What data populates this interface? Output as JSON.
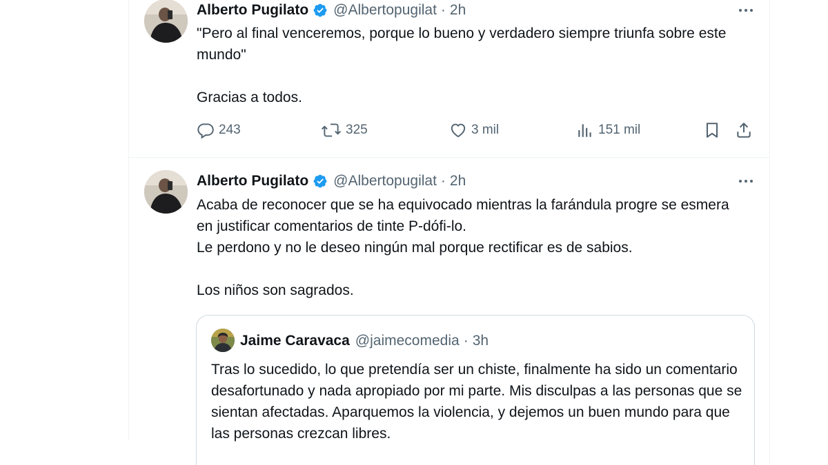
{
  "tweets": [
    {
      "author_name": "Alberto Pugilato",
      "handle": "@Albertopugilat",
      "separator": "·",
      "time": "2h",
      "paragraphs": [
        "\"Pero al final venceremos, porque lo bueno y verdadero siempre triunfa sobre este mundo\"",
        "Gracias a todos."
      ],
      "replies": "243",
      "retweets": "325",
      "likes": "3 mil",
      "views": "151 mil"
    },
    {
      "author_name": "Alberto Pugilato",
      "handle": "@Albertopugilat",
      "separator": "·",
      "time": "2h",
      "lines": [
        "Acaba de reconocer que se ha equivocado mientras la farándula progre se esmera en justificar comentarios de tinte P-dófi-lo.",
        "Le perdono y no le deseo ningún mal porque rectificar es de sabios.",
        "Los niños son sagrados."
      ],
      "quoted": {
        "author_name": "Jaime Caravaca",
        "handle": "@jaimecomedia",
        "separator": "·",
        "time": "3h",
        "text": "Tras lo sucedido, lo que pretendía ser un chiste, finalmente ha sido un comentario desafortunado y nada apropiado por mi parte. Mis disculpas a las personas que se sientan afectadas. Aparquemos la violencia, y dejemos un buen mundo para que las personas crezcan libres."
      }
    }
  ],
  "icons": {
    "verified": "verified-badge-icon",
    "more": "more-icon",
    "reply": "reply-icon",
    "retweet": "retweet-icon",
    "like": "heart-icon",
    "views": "views-icon",
    "bookmark": "bookmark-icon",
    "share": "share-icon"
  },
  "colors": {
    "text_primary": "#0f1419",
    "text_secondary": "#536471",
    "verified_blue": "#1d9bf0",
    "border": "#cfd9de"
  }
}
